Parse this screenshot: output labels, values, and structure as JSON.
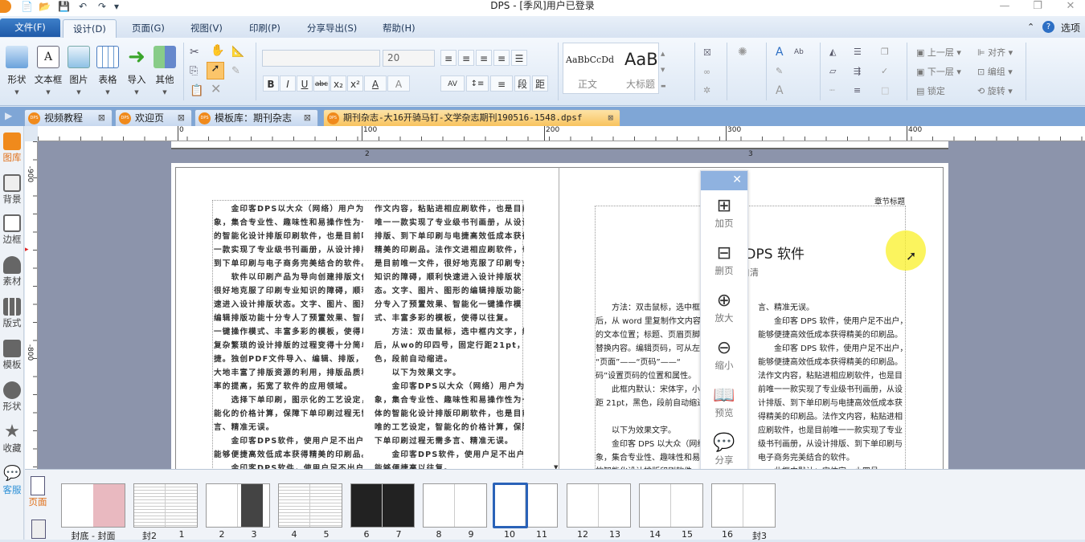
{
  "window": {
    "title": "DPS - [季风]用户已登录",
    "minimize": "—",
    "restore": "❐",
    "close": "✕"
  },
  "quick_access": [
    "📄",
    "📂",
    "💾",
    "↶",
    "↷",
    "▾"
  ],
  "menu": {
    "file": "文件(F)",
    "tabs": [
      "设计(D)",
      "页面(G)",
      "视图(V)",
      "印刷(P)",
      "分享导出(S)",
      "帮助(H)"
    ],
    "options": "选项",
    "help_icon": "?",
    "collapse": "⌃"
  },
  "ribbon": {
    "insert": [
      "形状",
      "文本框",
      "图片",
      "表格",
      "导入",
      "其他"
    ],
    "font_name": "",
    "font_size": "20",
    "format_buttons": [
      "B",
      "I",
      "U",
      "abc",
      "x₂",
      "x²",
      "A",
      "A"
    ],
    "para_buttons": [
      "AV",
      "↕≡",
      "≡",
      "段",
      "距"
    ],
    "styles": [
      {
        "sample": "AaBbCcDd",
        "name": "正文"
      },
      {
        "sample": "AaBb(",
        "name": "大标题"
      }
    ],
    "arrange": [
      "上一层",
      "下一层",
      "锁定",
      "对齐",
      "编组",
      "旋转"
    ]
  },
  "doc_tabs": [
    {
      "label": "视频教程"
    },
    {
      "label": "欢迎页"
    },
    {
      "label": "模板库：期刊杂志"
    },
    {
      "label": "期刊杂志-大16开骑马钉-文学杂志期刊190516-1548.dpsf",
      "active": true
    }
  ],
  "logo_text": "DPS",
  "sidebar": [
    "图库",
    "背景",
    "边框",
    "素材",
    "版式",
    "模板",
    "形状",
    "收藏",
    "客服"
  ],
  "ruler": {
    "h": [
      "0",
      "100",
      "200",
      "300",
      "400"
    ],
    "v": [
      "-900",
      "-800"
    ]
  },
  "spread": {
    "page_numbers": [
      "2",
      "3"
    ]
  },
  "left_page": {
    "col1": [
      "　　金印客DPS以大众（网络）用户为对",
      "象，集合专业性、趣味性和易操作性为一体",
      "的智能化设计排版印刷软件，也是目前唯一",
      "一款实现了专业级书刊画册，从设计排版、",
      "到下单印刷与电子商务完美结合的软件。",
      "　　软件以印刷产品为导向创建排版文件，",
      "很好地克服了印刷专业知识的障碍，顺利快",
      "速进入设计排版状态。文字、图片、图形的",
      "编辑排版功能十分专人了预置效果、智能化",
      "一键操作模式、丰富多彩的模板，使得以往",
      "复杂繁琐的设计排版的过程变得十分简单快",
      "捷。独创PDF文件导入、编辑、排版，极",
      "大地丰富了排版资源的利用，排版品质和效",
      "率的提高，拓宽了软件的应用领域。",
      "　　选择下单印刷，图示化的工艺设定，智",
      "能化的价格计算，保障下单印刷过程无需多",
      "言、精准无误。",
      "　　金印客DPS软件，使用户足不出户，",
      "能够便捷高效低成本获得精美的印刷品。",
      "　　金印客DPS软件，使用户足不出户，"
    ],
    "col2": [
      "作文内容，粘贴进相应刷软件，也是目前",
      "唯一一款实现了专业级书刊画册，从设计",
      "排版、到下单印刷与电捷高效低成本获得",
      "精美的印刷品。法作文进相应刷软件，也",
      "是目前唯一文件，很好地克服了印刷专业",
      "知识的障碍，顺利快速进入设计排版状",
      "态。文字、图片、图形的编辑排版功能十",
      "分专入了预置效果、智能化一键操作模",
      "式、丰富多彩的模板，使得以往复。",
      "　　方法：双击鼠标，选中框内文字，然",
      "后，从wo的印四号，固定行距21pt，黑",
      "色，段前自动缩进。",
      "　　以下为效果文字。",
      "　　金印客DPS以大众（网络）用户为对",
      "象，集合专业性、趣味性和易操作性为一",
      "体的智能化设计排版印刷软件，也是目前",
      "唯的工艺设定，智能化的价格计算，保障",
      "下单印刷过程无需多言、精准无误。",
      "　　金印客DPS软件，使用户足不出户，",
      "能够便捷高以往复。"
    ]
  },
  "right_page": {
    "header": "章节标题",
    "title": "金印客 DPS 软件",
    "subtitle": "自清",
    "col1": [
      "　　方法：双击鼠标，选中框",
      "后，从 word 里复制作文内容，",
      "的文本位置；标题、页眉页脚七",
      "替换内容。编辑页码，可从左上",
      "“页面”——“页码”——“",
      "码”设置页码的位置和属性。",
      "　　此框内默认：宋体字，小四",
      "距 21pt，黑色，段前自动缩进。",
      "",
      "　　以下为效果文字。",
      "　　金印客 DPS 以大众（网络",
      "象，集合专业性、趣味性和易操",
      "的智能化设计排版印刷软件，"
    ],
    "col2": [
      "言、精准无误。",
      "　　金印客 DPS 软件，使用户足不出户，",
      "能够便捷高效低成本获得精美的印刷品。",
      "　　金印客 DPS 软件，使用户足不出户，",
      "能够便捷高效低成本获得精美的印刷品。",
      "法作文内容，粘贴进相应刷软件，也是目",
      "前唯一一款实现了专业级书刊画册，从设",
      "计排版、到下单印刷与电捷高效低成本获",
      "得精美的印刷品。法作文内容，粘贴进相",
      "应刷软件，也是目前唯一一款实现了专业",
      "级书刊画册，从设计排版、到下单印刷与",
      "电子商务完美结合的软件。",
      "　　此框内默认：宋体字，小四号"
    ]
  },
  "float_panel": {
    "close": "✕",
    "items": [
      {
        "icon": "⊞",
        "label": "加页"
      },
      {
        "icon": "⊟",
        "label": "删页"
      },
      {
        "icon": "⊕",
        "label": "放大"
      },
      {
        "icon": "⊖",
        "label": "缩小"
      },
      {
        "icon": "📖",
        "label": "预览"
      },
      {
        "icon": "💬",
        "label": "分享"
      }
    ]
  },
  "thumbs": {
    "tab_label": "页面",
    "spreads": [
      [
        "封底 - 封面"
      ],
      [
        "封2",
        "1"
      ],
      [
        "2",
        "3"
      ],
      [
        "4",
        "5"
      ],
      [
        "6",
        "7"
      ],
      [
        "8",
        "9"
      ],
      [
        "10",
        "11"
      ],
      [
        "12",
        "13"
      ],
      [
        "14",
        "15"
      ],
      [
        "16",
        "封3"
      ]
    ],
    "selected_page": "10"
  },
  "colors": {
    "accent": "#f08a1c",
    "selected": "#2a62b8",
    "canvas": "#8c94ab"
  }
}
